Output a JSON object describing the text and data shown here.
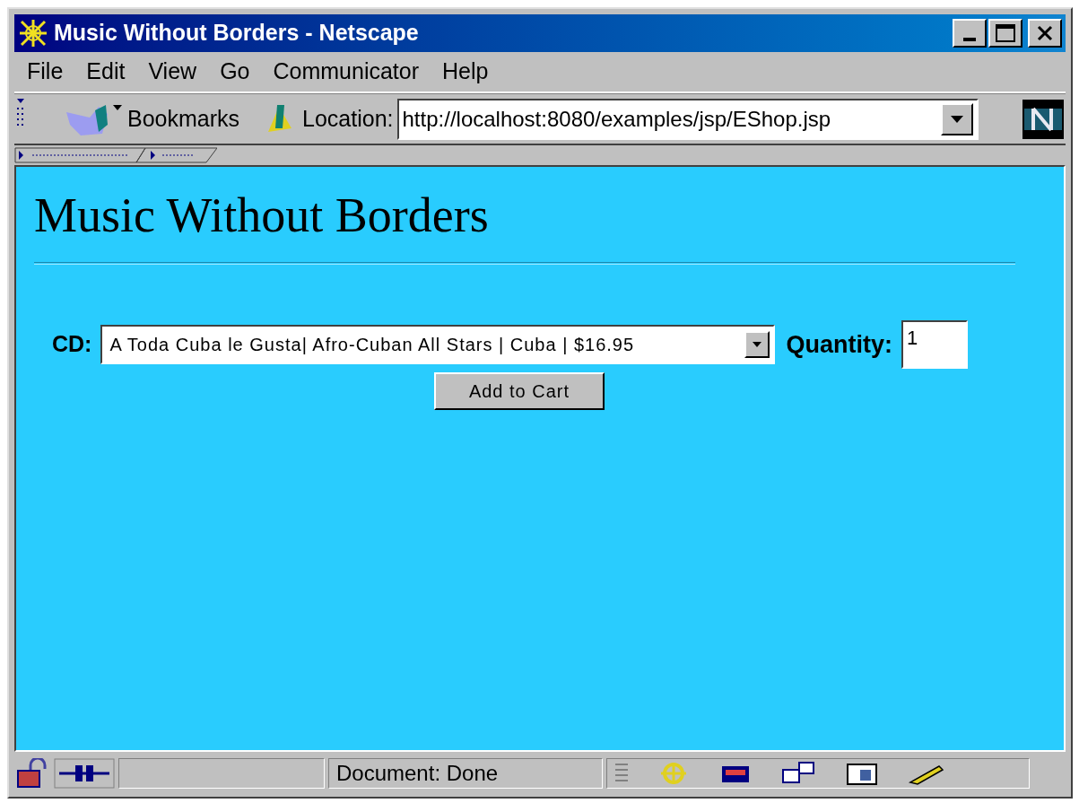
{
  "window": {
    "title": "Music Without Borders - Netscape"
  },
  "menu": [
    "File",
    "Edit",
    "View",
    "Go",
    "Communicator",
    "Help"
  ],
  "toolbar": {
    "bookmarks": "Bookmarks",
    "location_label": "Location:",
    "url": "http://localhost:8080/examples/jsp/EShop.jsp"
  },
  "page": {
    "heading": "Music Without Borders",
    "cd_label": "CD:",
    "cd_value": "A Toda Cuba le Gusta| Afro-Cuban All Stars | Cuba | $16.95",
    "quantity_label": "Quantity:",
    "quantity_value": "1",
    "button": "Add to Cart"
  },
  "status_bar": {
    "text": "Document: Done"
  }
}
